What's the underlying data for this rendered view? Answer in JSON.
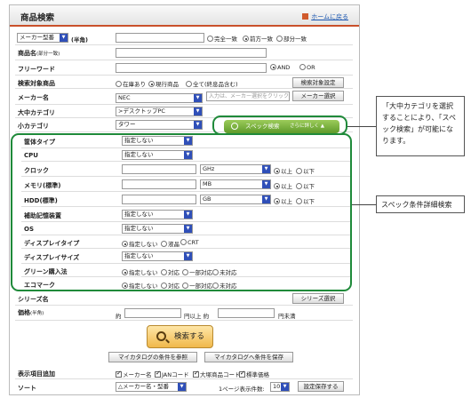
{
  "header": {
    "title": "商品検索",
    "home_link": "ホームに戻る"
  },
  "rows": {
    "maker_model": {
      "select_value": "メーカー型番",
      "suffix": "(半角)",
      "options": [
        "完全一致",
        "前方一致",
        "部分一致"
      ],
      "selected": "前方一致"
    },
    "product_name": {
      "label": "商品名",
      "suffix": "(部分一致)"
    },
    "freeword": {
      "label": "フリーワード",
      "options": [
        "AND",
        "OR"
      ],
      "selected": "AND"
    },
    "target": {
      "label": "検索対象商品",
      "options": [
        "在庫あり",
        "現行商品",
        "全て(終息品含む)"
      ],
      "selected": "現行商品",
      "button": "検索対象設定"
    },
    "maker": {
      "label": "メーカー名",
      "value": "NEC",
      "placeholder": "入力は、メーカー選択をクリック",
      "button": "メーカー選択"
    },
    "large_cat": {
      "label": "大中カテゴリ",
      "value": ">デスクトップPC"
    },
    "small_cat": {
      "label": "小カテゴリ",
      "value": "タワー"
    }
  },
  "spec_tab": {
    "label": "スペック検索",
    "sub": "さらに詳しく ▲"
  },
  "spec_rows": {
    "case_type": {
      "label": "筐体タイプ",
      "value": "指定しない"
    },
    "cpu": {
      "label": "CPU",
      "value": "指定しない"
    },
    "clock": {
      "label": "クロック",
      "unit": "GHz",
      "options": [
        "以上",
        "以下"
      ],
      "selected": "以上"
    },
    "memory": {
      "label": "メモリ(標準)",
      "unit": "MB",
      "options": [
        "以上",
        "以下"
      ],
      "selected": "以上"
    },
    "hdd": {
      "label": "HDD(標準)",
      "unit": "GB",
      "options": [
        "以上",
        "以下"
      ],
      "selected": "以上"
    },
    "storage": {
      "label": "補助記憶装置",
      "value": "指定しない"
    },
    "os": {
      "label": "OS",
      "value": "指定しない"
    },
    "display_type": {
      "label": "ディスプレイタイプ",
      "options": [
        "指定しない",
        "液晶",
        "CRT"
      ],
      "selected": "指定しない"
    },
    "display_size": {
      "label": "ディスプレイサイズ",
      "value": "指定しない"
    },
    "green": {
      "label": "グリーン購入法",
      "options": [
        "指定しない",
        "対応",
        "一部対応",
        "未対応"
      ],
      "selected": "指定しない"
    },
    "eco": {
      "label": "エコマーク",
      "options": [
        "指定しない",
        "対応",
        "一部対応",
        "未対応"
      ],
      "selected": "指定しない"
    }
  },
  "series": {
    "label": "シリーズ名",
    "button": "シリーズ選択"
  },
  "price": {
    "label": "価格",
    "suffix": "(半角)",
    "pre": "約",
    "mid": "円以上 約",
    "post": "円未満"
  },
  "search_button": "検索する",
  "catalog": {
    "ref": "マイカタログの条件を参照",
    "save": "マイカタログへ条件を保存"
  },
  "display_items": {
    "label": "表示項目追加",
    "items": [
      "メーカー名",
      "JANコード",
      "大塚商品コード",
      "標準価格"
    ]
  },
  "sort": {
    "label": "ソート",
    "value": "△メーカー名・型番",
    "per_page_label": "1ページ表示件数:",
    "per_page": "10",
    "save_button": "設定保存する"
  },
  "callouts": {
    "spec": "「大中カテゴリを選択することにより、「スペック検索」が可能になります。",
    "detail": "スペック条件詳細検索"
  },
  "colors": {
    "accent": "#c9502a",
    "spec_green": "#6aa832",
    "frame_green": "#1f8a3a",
    "select_arrow": "#2f4fb8"
  }
}
